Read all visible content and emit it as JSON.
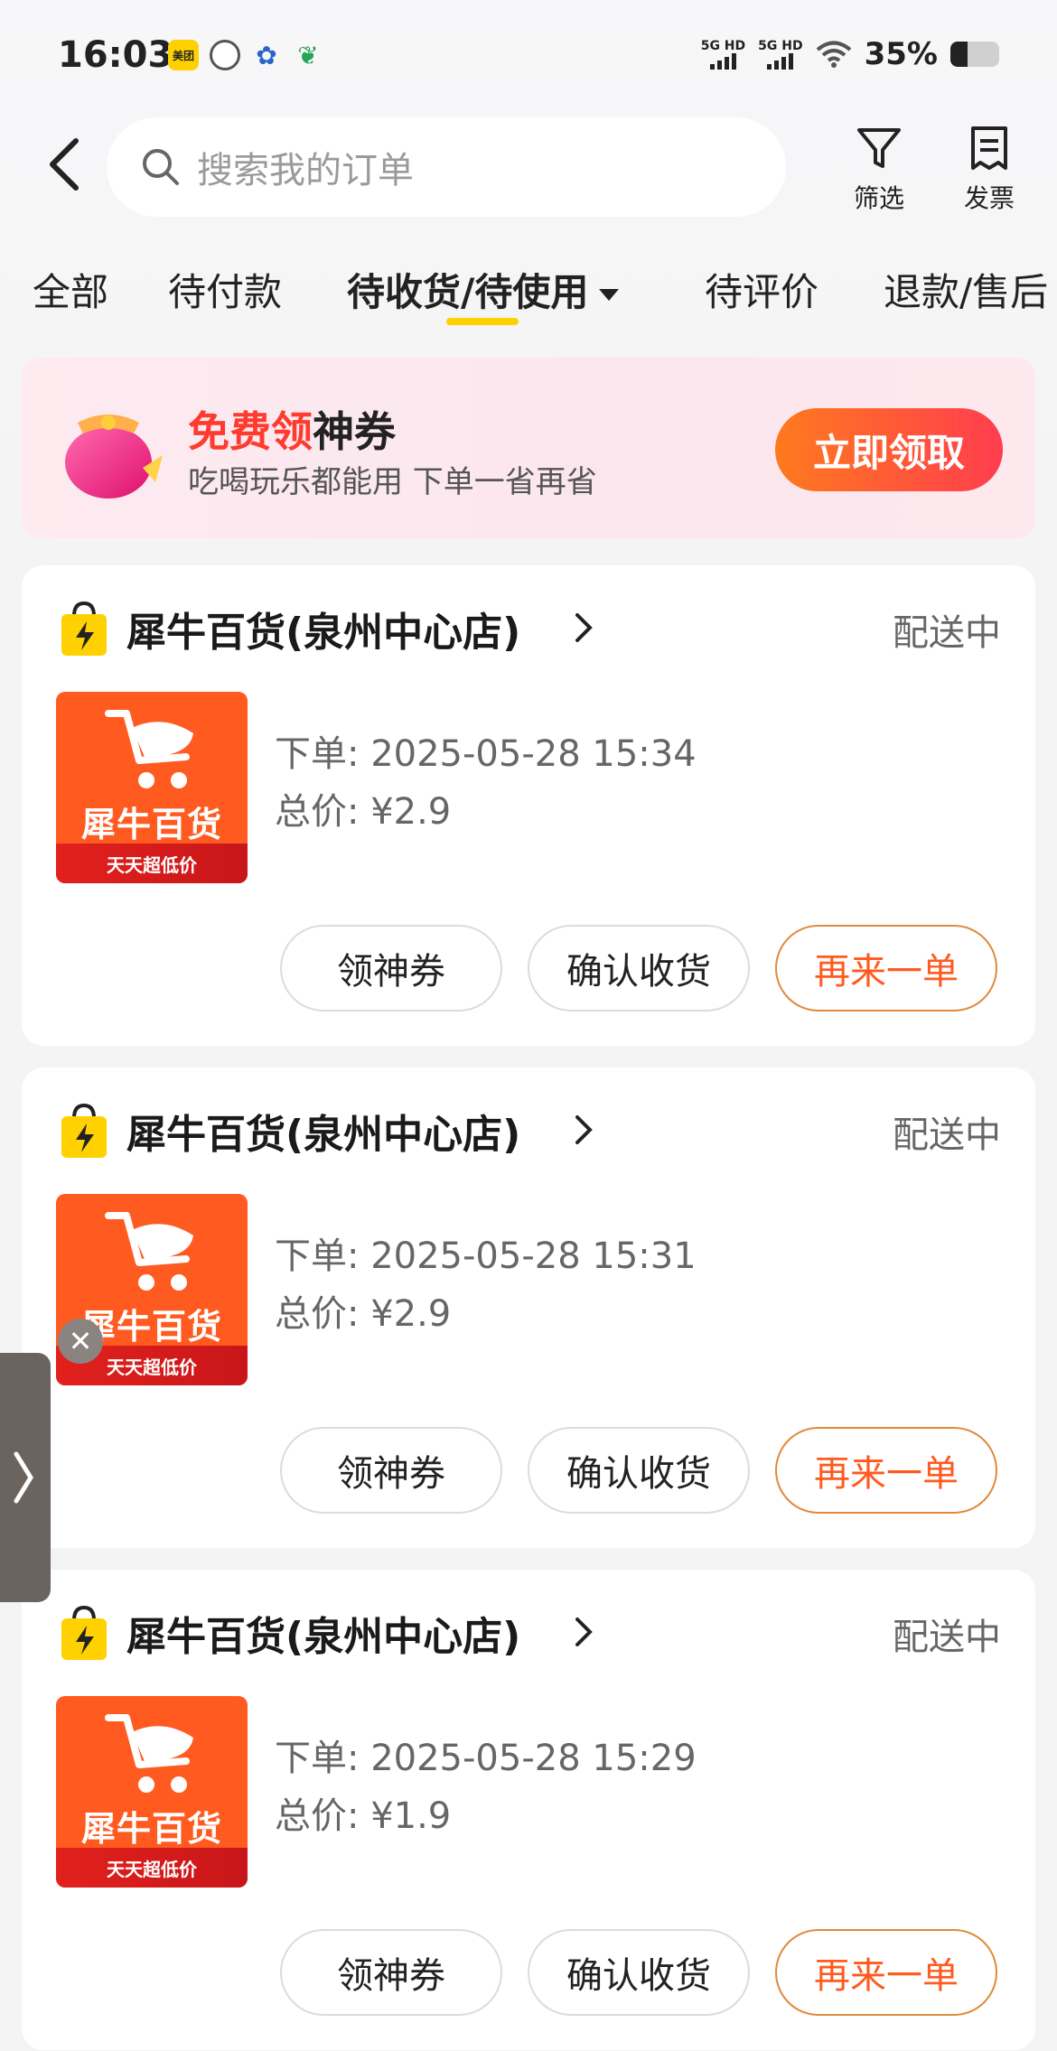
{
  "status_bar": {
    "time": "16:03",
    "app_icons": [
      "meituan-icon",
      "compass-icon",
      "paw-icon",
      "leaf-icon"
    ],
    "meituan_badge": "美团",
    "signal1_label": "5G HD",
    "signal2_label": "5G HD",
    "battery_pct": "35%",
    "battery_level": 0.35
  },
  "header": {
    "search_placeholder": "搜索我的订单",
    "filter_label": "筛选",
    "invoice_label": "发票"
  },
  "tabs": [
    {
      "label": "全部"
    },
    {
      "label": "待付款"
    },
    {
      "label": "待收货/待使用"
    },
    {
      "label": "待评价"
    },
    {
      "label": "退款/售后"
    }
  ],
  "active_tab": "待收货/待使用",
  "banner": {
    "title_highlight": "免费领",
    "title_rest": "神券",
    "subtitle": "吃喝玩乐都能用 下单一省再省",
    "button": "立即领取"
  },
  "orders": [
    {
      "shop": "犀牛百货(泉州中心店)",
      "status": "配送中",
      "thumb_brand": "犀牛百货",
      "thumb_ribbon": "天天超低价",
      "order_time": "下单: 2025-05-28 15:34",
      "total": "总价: ¥2.9",
      "actions": [
        "领神券",
        "确认收货",
        "再来一单"
      ]
    },
    {
      "shop": "犀牛百货(泉州中心店)",
      "status": "配送中",
      "thumb_brand": "犀牛百货",
      "thumb_ribbon": "天天超低价",
      "order_time": "下单: 2025-05-28 15:31",
      "total": "总价: ¥2.9",
      "actions": [
        "领神券",
        "确认收货",
        "再来一单"
      ]
    },
    {
      "shop": "犀牛百货(泉州中心店)",
      "status": "配送中",
      "thumb_brand": "犀牛百货",
      "thumb_ribbon": "天天超低价",
      "order_time": "下单: 2025-05-28 15:29",
      "total": "总价: ¥1.9",
      "actions": [
        "领神券",
        "确认收货",
        "再来一单"
      ]
    }
  ],
  "colors": {
    "accent_yellow": "#ffd100",
    "action_orange": "#ff5a1f",
    "banner_red": "#ff3a2e"
  }
}
